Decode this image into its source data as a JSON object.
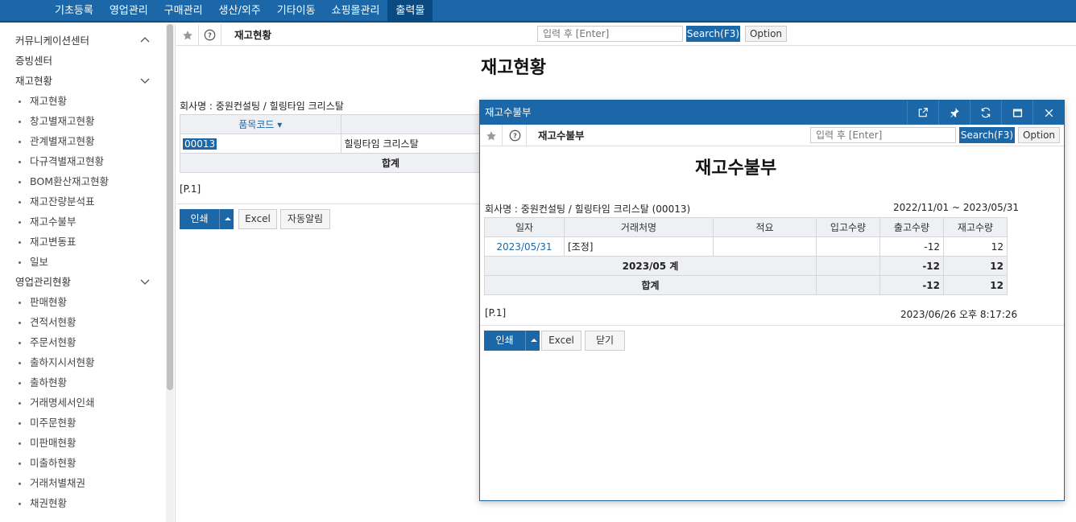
{
  "topnav": {
    "items": [
      "기초등록",
      "영업관리",
      "구매관리",
      "생산/외주",
      "기타이동",
      "쇼핑몰관리",
      "출력물"
    ],
    "active_index": 6
  },
  "sidebar": {
    "sections": [
      {
        "label": "커뮤니케이션센터",
        "chevron": "up",
        "items": []
      },
      {
        "label": "증빙센터",
        "chevron": "",
        "items": []
      },
      {
        "label": "재고현황",
        "chevron": "down",
        "items": [
          "재고현황",
          "창고별재고현황",
          "관계별재고현황",
          "다규격별재고현황",
          "BOM환산재고현황",
          "재고잔량분석표",
          "재고수불부",
          "재고변동표",
          "일보"
        ]
      },
      {
        "label": "영업관리현황",
        "chevron": "down",
        "items": [
          "판매현황",
          "견적서현황",
          "주문서현황",
          "출하지시서현황",
          "출하현황",
          "거래명세서인쇄",
          "미주문현황",
          "미판매현황",
          "미출하현황",
          "거래처별채권",
          "채권현황"
        ]
      }
    ]
  },
  "main": {
    "toolbar_title": "재고현황",
    "search_placeholder": "입력 후 [Enter]",
    "search_label": "Search(F3)",
    "option_label": "Option",
    "page_title": "재고현황",
    "company": "회사명 : 중원컨설팅 / 힐링타임 크리스탈",
    "table": {
      "header_code": "품목코드 ▾",
      "row_code": "00013",
      "row_name": "힐링타임 크리스탈",
      "sum_label": "합계"
    },
    "page_label": "[P.1]",
    "print_label": "인쇄",
    "excel_label": "Excel",
    "alert_label": "자동알림"
  },
  "popup": {
    "title": "재고수불부",
    "toolbar_title": "재고수불부",
    "search_placeholder": "입력 후 [Enter]",
    "search_label": "Search(F3)",
    "option_label": "Option",
    "page_title": "재고수불부",
    "company": "회사명 : 중원컨설팅 / 힐링타임 크리스탈 (00013)",
    "date_range": "2022/11/01 ~ 2023/05/31",
    "columns": [
      "일자",
      "거래처명",
      "적요",
      "입고수량",
      "출고수량",
      "재고수량"
    ],
    "row": {
      "date": "2023/05/31",
      "partner": "[조정]",
      "memo": "",
      "in": "",
      "out": "-12",
      "stock": "12"
    },
    "subtotal": {
      "label": "2023/05 계",
      "out": "-12",
      "stock": "12"
    },
    "total": {
      "label": "합계",
      "out": "-12",
      "stock": "12"
    },
    "page_label": "[P.1]",
    "timestamp": "2023/06/26 오후 8:17:26",
    "print_label": "인쇄",
    "excel_label": "Excel",
    "close_label": "닫기"
  }
}
